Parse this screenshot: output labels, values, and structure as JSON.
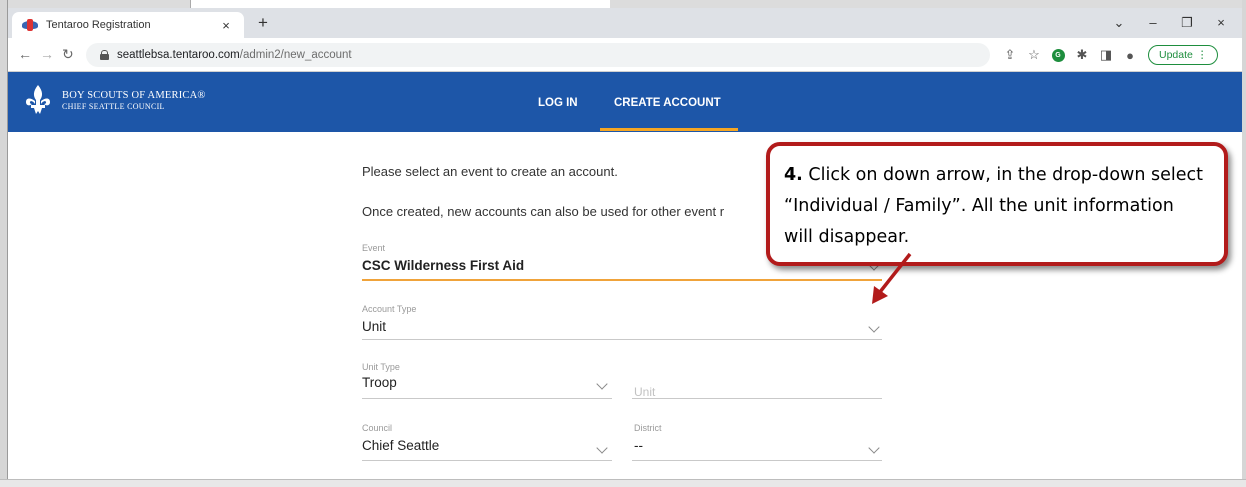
{
  "browser": {
    "tab_title": "Tentaroo Registration",
    "tab_close": "×",
    "new_tab": "+",
    "controls": {
      "chevron": "⌄",
      "minimize": "–",
      "restore": "❐",
      "close": "×"
    },
    "url_host": "seattlebsa.tentaroo.com",
    "url_path": "/admin2/new_account",
    "update_label": "Update",
    "update_menu": "⋮"
  },
  "site": {
    "org_line1": "BOY SCOUTS OF AMERICA®",
    "org_line2": "CHIEF SEATTLE COUNCIL",
    "nav": {
      "login": "LOG IN",
      "create_account": "CREATE ACCOUNT"
    },
    "brand_color": "#1d56a8",
    "accent_color": "#f5a623"
  },
  "form": {
    "intro1": "Please select an event to create an account.",
    "intro2": "Once created, new accounts can also be used for other event r",
    "event": {
      "label": "Event",
      "value": "CSC Wilderness First Aid"
    },
    "account_type": {
      "label": "Account Type",
      "value": "Unit"
    },
    "unit_type": {
      "label": "Unit Type",
      "value": "Troop"
    },
    "unit": {
      "placeholder": "Unit"
    },
    "council": {
      "label": "Council",
      "value": "Chief Seattle"
    },
    "district": {
      "label": "District",
      "value": "--"
    }
  },
  "callout": {
    "step": "4.",
    "text": " Click on down arrow, in the drop-down select “Individual / Family”. All the unit information will disappear.",
    "border_color": "#b21b1b"
  }
}
